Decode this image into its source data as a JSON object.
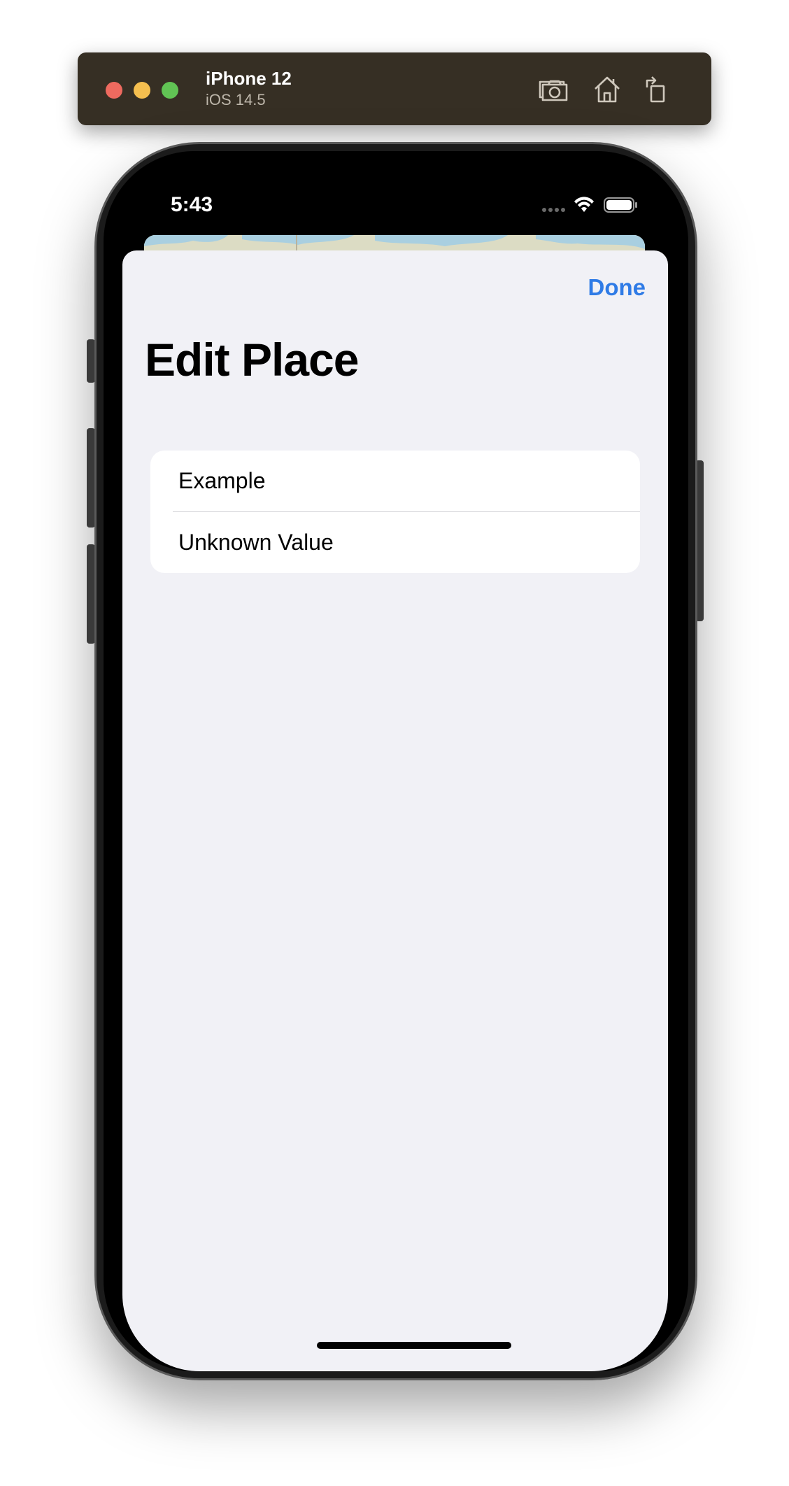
{
  "simulator": {
    "device_name": "iPhone 12",
    "os_version": "iOS 14.5",
    "toolbar_icons": [
      "screenshot-icon",
      "home-icon",
      "rotate-icon"
    ]
  },
  "status_bar": {
    "time": "5:43",
    "icons": [
      "signal-icon",
      "wifi-icon",
      "battery-icon"
    ]
  },
  "sheet": {
    "done_label": "Done",
    "title": "Edit Place",
    "rows": [
      {
        "label": "Example"
      },
      {
        "label": "Unknown Value"
      }
    ]
  },
  "colors": {
    "accent": "#2f7be6",
    "sheet_background": "#f1f1f6",
    "card_background": "#ffffff",
    "simulator_bar": "#362f24"
  }
}
